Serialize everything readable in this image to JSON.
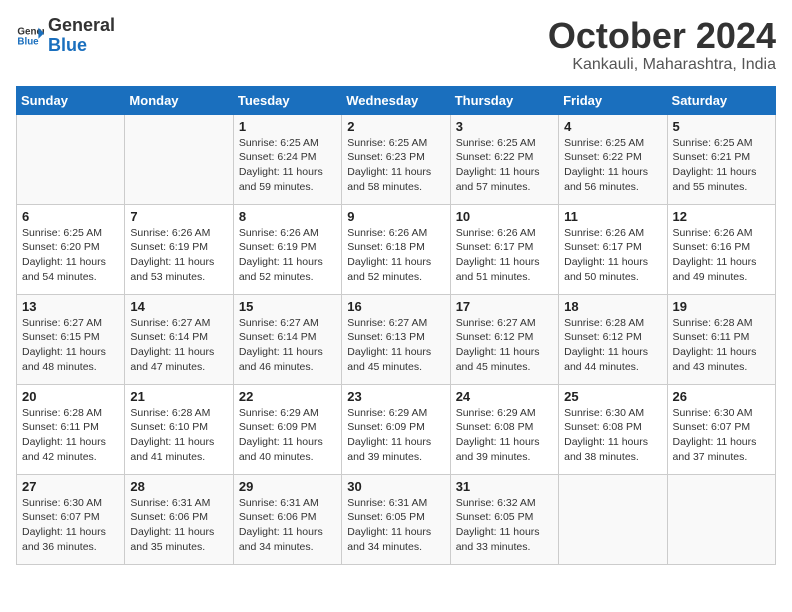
{
  "logo": {
    "general": "General",
    "blue": "Blue"
  },
  "header": {
    "month": "October 2024",
    "location": "Kankauli, Maharashtra, India"
  },
  "weekdays": [
    "Sunday",
    "Monday",
    "Tuesday",
    "Wednesday",
    "Thursday",
    "Friday",
    "Saturday"
  ],
  "weeks": [
    [
      {
        "day": "",
        "info": ""
      },
      {
        "day": "",
        "info": ""
      },
      {
        "day": "1",
        "info": "Sunrise: 6:25 AM\nSunset: 6:24 PM\nDaylight: 11 hours and 59 minutes."
      },
      {
        "day": "2",
        "info": "Sunrise: 6:25 AM\nSunset: 6:23 PM\nDaylight: 11 hours and 58 minutes."
      },
      {
        "day": "3",
        "info": "Sunrise: 6:25 AM\nSunset: 6:22 PM\nDaylight: 11 hours and 57 minutes."
      },
      {
        "day": "4",
        "info": "Sunrise: 6:25 AM\nSunset: 6:22 PM\nDaylight: 11 hours and 56 minutes."
      },
      {
        "day": "5",
        "info": "Sunrise: 6:25 AM\nSunset: 6:21 PM\nDaylight: 11 hours and 55 minutes."
      }
    ],
    [
      {
        "day": "6",
        "info": "Sunrise: 6:25 AM\nSunset: 6:20 PM\nDaylight: 11 hours and 54 minutes."
      },
      {
        "day": "7",
        "info": "Sunrise: 6:26 AM\nSunset: 6:19 PM\nDaylight: 11 hours and 53 minutes."
      },
      {
        "day": "8",
        "info": "Sunrise: 6:26 AM\nSunset: 6:19 PM\nDaylight: 11 hours and 52 minutes."
      },
      {
        "day": "9",
        "info": "Sunrise: 6:26 AM\nSunset: 6:18 PM\nDaylight: 11 hours and 52 minutes."
      },
      {
        "day": "10",
        "info": "Sunrise: 6:26 AM\nSunset: 6:17 PM\nDaylight: 11 hours and 51 minutes."
      },
      {
        "day": "11",
        "info": "Sunrise: 6:26 AM\nSunset: 6:17 PM\nDaylight: 11 hours and 50 minutes."
      },
      {
        "day": "12",
        "info": "Sunrise: 6:26 AM\nSunset: 6:16 PM\nDaylight: 11 hours and 49 minutes."
      }
    ],
    [
      {
        "day": "13",
        "info": "Sunrise: 6:27 AM\nSunset: 6:15 PM\nDaylight: 11 hours and 48 minutes."
      },
      {
        "day": "14",
        "info": "Sunrise: 6:27 AM\nSunset: 6:14 PM\nDaylight: 11 hours and 47 minutes."
      },
      {
        "day": "15",
        "info": "Sunrise: 6:27 AM\nSunset: 6:14 PM\nDaylight: 11 hours and 46 minutes."
      },
      {
        "day": "16",
        "info": "Sunrise: 6:27 AM\nSunset: 6:13 PM\nDaylight: 11 hours and 45 minutes."
      },
      {
        "day": "17",
        "info": "Sunrise: 6:27 AM\nSunset: 6:12 PM\nDaylight: 11 hours and 45 minutes."
      },
      {
        "day": "18",
        "info": "Sunrise: 6:28 AM\nSunset: 6:12 PM\nDaylight: 11 hours and 44 minutes."
      },
      {
        "day": "19",
        "info": "Sunrise: 6:28 AM\nSunset: 6:11 PM\nDaylight: 11 hours and 43 minutes."
      }
    ],
    [
      {
        "day": "20",
        "info": "Sunrise: 6:28 AM\nSunset: 6:11 PM\nDaylight: 11 hours and 42 minutes."
      },
      {
        "day": "21",
        "info": "Sunrise: 6:28 AM\nSunset: 6:10 PM\nDaylight: 11 hours and 41 minutes."
      },
      {
        "day": "22",
        "info": "Sunrise: 6:29 AM\nSunset: 6:09 PM\nDaylight: 11 hours and 40 minutes."
      },
      {
        "day": "23",
        "info": "Sunrise: 6:29 AM\nSunset: 6:09 PM\nDaylight: 11 hours and 39 minutes."
      },
      {
        "day": "24",
        "info": "Sunrise: 6:29 AM\nSunset: 6:08 PM\nDaylight: 11 hours and 39 minutes."
      },
      {
        "day": "25",
        "info": "Sunrise: 6:30 AM\nSunset: 6:08 PM\nDaylight: 11 hours and 38 minutes."
      },
      {
        "day": "26",
        "info": "Sunrise: 6:30 AM\nSunset: 6:07 PM\nDaylight: 11 hours and 37 minutes."
      }
    ],
    [
      {
        "day": "27",
        "info": "Sunrise: 6:30 AM\nSunset: 6:07 PM\nDaylight: 11 hours and 36 minutes."
      },
      {
        "day": "28",
        "info": "Sunrise: 6:31 AM\nSunset: 6:06 PM\nDaylight: 11 hours and 35 minutes."
      },
      {
        "day": "29",
        "info": "Sunrise: 6:31 AM\nSunset: 6:06 PM\nDaylight: 11 hours and 34 minutes."
      },
      {
        "day": "30",
        "info": "Sunrise: 6:31 AM\nSunset: 6:05 PM\nDaylight: 11 hours and 34 minutes."
      },
      {
        "day": "31",
        "info": "Sunrise: 6:32 AM\nSunset: 6:05 PM\nDaylight: 11 hours and 33 minutes."
      },
      {
        "day": "",
        "info": ""
      },
      {
        "day": "",
        "info": ""
      }
    ]
  ]
}
